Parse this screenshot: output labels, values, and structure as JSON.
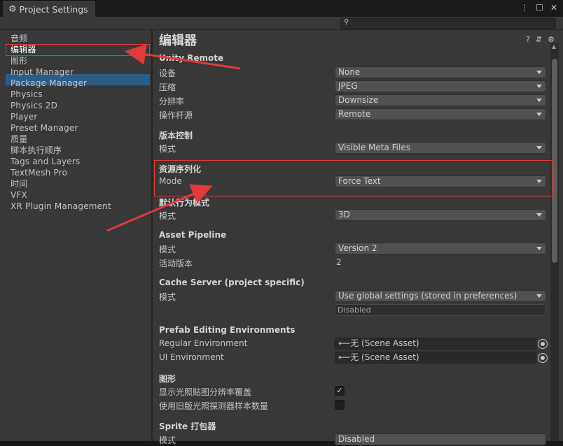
{
  "window": {
    "tab_title": "Project Settings",
    "controls": [
      "⋮",
      "☐",
      "✕"
    ]
  },
  "search": {
    "placeholder": ""
  },
  "sidebar": {
    "items": [
      {
        "label": "音频"
      },
      {
        "label": "编辑器",
        "selected": true
      },
      {
        "label": "图形"
      },
      {
        "label": "Input Manager"
      },
      {
        "label": "Package Manager"
      },
      {
        "label": "Physics"
      },
      {
        "label": "Physics 2D"
      },
      {
        "label": "Player"
      },
      {
        "label": "Preset Manager"
      },
      {
        "label": "质量"
      },
      {
        "label": "脚本执行顺序"
      },
      {
        "label": "Tags and Layers"
      },
      {
        "label": "TextMesh Pro"
      },
      {
        "label": "时间"
      },
      {
        "label": "VFX"
      },
      {
        "label": "XR Plugin Management"
      }
    ]
  },
  "page": {
    "title": "编辑器",
    "header_icons": [
      "?",
      "⇵",
      "⚙"
    ]
  },
  "sections": {
    "unity_remote": {
      "title": "Unity Remote",
      "device_label": "设备",
      "device_value": "None",
      "compression_label": "压缩",
      "compression_value": "JPEG",
      "resolution_label": "分辨率",
      "resolution_value": "Downsize",
      "joystick_label": "操作杆源",
      "joystick_value": "Remote"
    },
    "version_control": {
      "title": "版本控制",
      "mode_label": "模式",
      "mode_value": "Visible Meta Files"
    },
    "asset_serialization": {
      "title": "资源序列化",
      "mode_label": "Mode",
      "mode_value": "Force Text"
    },
    "default_behavior": {
      "title": "默认行为模式",
      "mode_label": "模式",
      "mode_value": "3D"
    },
    "asset_pipeline": {
      "title": "Asset Pipeline",
      "mode_label": "模式",
      "mode_value": "Version 2",
      "active_label": "活动版本",
      "active_value": "2"
    },
    "cache_server": {
      "title": "Cache Server (project specific)",
      "mode_label": "模式",
      "mode_value": "Use global settings (stored in preferences)",
      "status_value": "Disabled"
    },
    "prefab_env": {
      "title": "Prefab Editing Environments",
      "regular_label": "Regular Environment",
      "regular_value": "无 (Scene Asset)",
      "ui_label": "UI Environment",
      "ui_value": "无 (Scene Asset)"
    },
    "graphics": {
      "title": "图形",
      "lightmap_label": "显示光照贴图分辨率覆盖",
      "lightmap_checked": true,
      "probe_label": "使用旧版光照探测器样本数量",
      "probe_checked": false
    },
    "sprite_packer": {
      "title": "Sprite 打包器",
      "mode_label": "模式",
      "mode_value": "Disabled"
    }
  },
  "colors": {
    "selection": "#2c5d87",
    "annotation_red": "#e03a3a"
  }
}
